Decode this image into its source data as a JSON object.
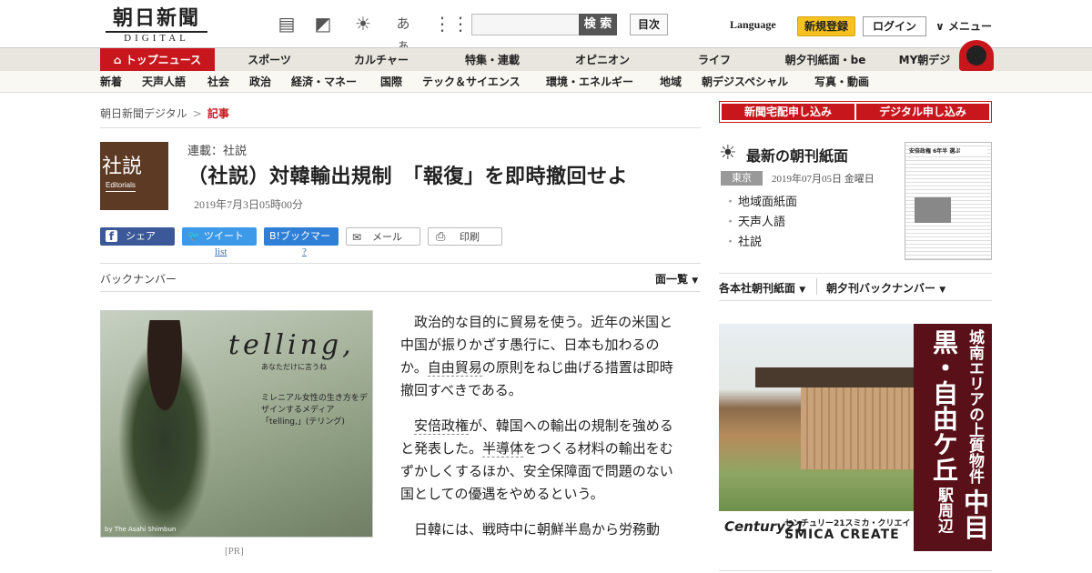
{
  "header": {
    "logo_main": "朝日新聞",
    "logo_sub": "DIGITAL",
    "search_button": "検 索",
    "search_placeholder": "",
    "mokuji": "目次",
    "language": "Language",
    "register": "新規登録",
    "login": "ログイン",
    "menu": "メニュー",
    "font_size_label": "あぁ"
  },
  "nav_primary": [
    "トップニュース",
    "スポーツ",
    "カルチャー",
    "特集・連載",
    "オピニオン",
    "ライフ",
    "朝夕刊紙面・be",
    "MY朝デジ"
  ],
  "nav_secondary": [
    "新着",
    "天声人語",
    "社会",
    "政治",
    "経済・マネー",
    "国際",
    "テック＆サイエンス",
    "環境・エネルギー",
    "地域",
    "朝デジスペシャル",
    "写真・動画"
  ],
  "breadcrumb": {
    "home": "朝日新聞デジタル",
    "sep": ">",
    "current": "記事"
  },
  "article": {
    "icon_text": "社説",
    "icon_en": "Editorials",
    "series": "連載：社説",
    "title": "（社説）対韓輸出規制　「報復」を即時撤回せよ",
    "date": "2019年7月3日05時00分",
    "share": {
      "facebook": "シェア",
      "twitter": "ツイート",
      "hatena": "B!ブックマーク",
      "mail": "メール",
      "print": "印刷",
      "twitter_sub": "list",
      "hatena_sub": "?"
    },
    "backnumber": "バックナンバー",
    "menlist": "面一覧",
    "p1_a": "政治的な目的に貿易を使う。近年の米国と中国が振りかざす愚行に、日本も加わるのか。",
    "p1_kw": "自由貿易",
    "p1_b": "の原則をねじ曲げる措置は即時撤回すべきである。",
    "p2_kw1": "安倍政権",
    "p2_a": "が、韓国への輸出の規制を強めると発表した。",
    "p2_kw2": "半導体",
    "p2_b": "をつくる材料の輸出をむずかしくするほか、安全保障面で問題のない国としての優遇をやめるという。",
    "p3": "日韓には、戦時中に朝鮮半島から労務動"
  },
  "pr_ad": {
    "logo": "telling,",
    "tag": "あなただけに言うね",
    "copy": "ミレニアル女性の生き方をデザインするメディア「telling,」(テリング)",
    "by": "by The Asahi Shimbun",
    "label": "[PR]"
  },
  "sidebar": {
    "btn_delivery": "新聞宅配申し込み",
    "btn_digital": "デジタル申し込み",
    "chokan_title": "最新の朝刊紙面",
    "location": "東京",
    "chokan_date": "2019年07月05日 金曜日",
    "links": [
      "地域面紙面",
      "天声人語",
      "社説"
    ],
    "paper_head": "安倍政権 6年半 選ぶ",
    "menu_a": "各本社朝刊紙面",
    "menu_b": "朝夕刊バックナンバー"
  },
  "ad_right": {
    "copy1": "城南エリアの上質物件",
    "copy2": "中目黒・自由ケ丘",
    "copy3": "駅周辺",
    "brand": "Century21",
    "company_jp": "センチュリー21スミカ・クリエイト",
    "company_en": "SMICA CREATE"
  }
}
